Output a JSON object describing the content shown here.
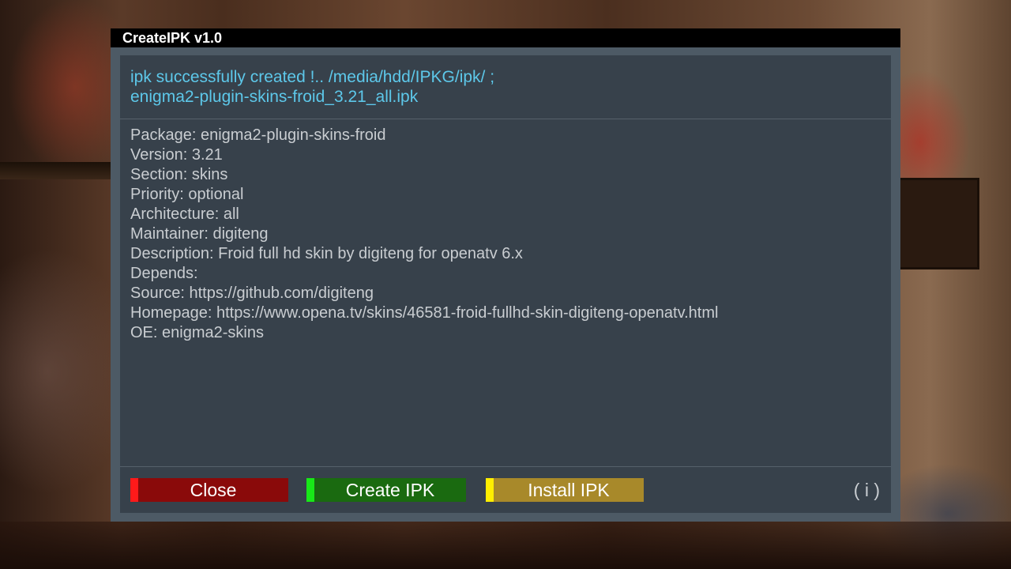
{
  "window": {
    "title": "CreateIPK v1.0"
  },
  "status": {
    "line1": "ipk successfully created !.. /media/hdd/IPKG/ipk/ ;",
    "line2": "enigma2-plugin-skins-froid_3.21_all.ipk"
  },
  "package_info": [
    "Package: enigma2-plugin-skins-froid",
    "Version: 3.21",
    "Section: skins",
    "Priority: optional",
    "Architecture: all",
    "Maintainer: digiteng",
    "Description: Froid full hd skin by digiteng for openatv 6.x",
    "Depends:",
    "Source: https://github.com/digiteng",
    "Homepage: https://www.opena.tv/skins/46581-froid-fullhd-skin-digiteng-openatv.html",
    "OE: enigma2-skins"
  ],
  "buttons": {
    "close_label": "Close",
    "create_label": "Create IPK",
    "install_label": "Install IPK",
    "info_label": "( i )"
  },
  "colors": {
    "status_text": "#5dc8ea",
    "close_key": "#ff1a1a",
    "create_key": "#18e818",
    "install_key": "#ffee00"
  }
}
